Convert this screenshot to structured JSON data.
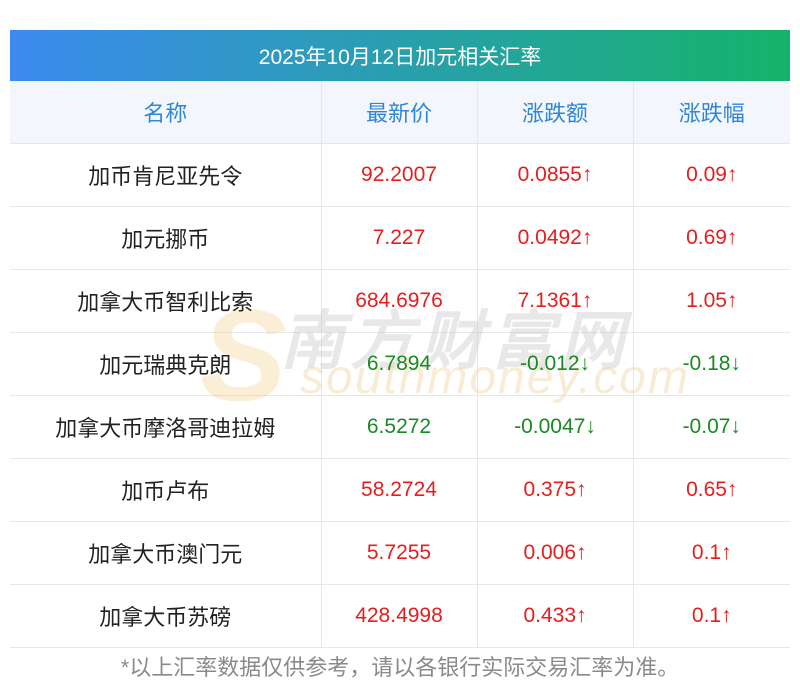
{
  "title": "2025年10月12日加元相关汇率",
  "columns": [
    "名称",
    "最新价",
    "涨跌额",
    "涨跌幅"
  ],
  "rows": [
    {
      "name": "加币肯尼亚先令",
      "price": "92.2007",
      "change": "0.0855↑",
      "pct": "0.09↑",
      "dir": "up"
    },
    {
      "name": "加元挪币",
      "price": "7.227",
      "change": "0.0492↑",
      "pct": "0.69↑",
      "dir": "up"
    },
    {
      "name": "加拿大币智利比索",
      "price": "684.6976",
      "change": "7.1361↑",
      "pct": "1.05↑",
      "dir": "up"
    },
    {
      "name": "加元瑞典克朗",
      "price": "6.7894",
      "change": "-0.012↓",
      "pct": "-0.18↓",
      "dir": "down"
    },
    {
      "name": "加拿大币摩洛哥迪拉姆",
      "price": "6.5272",
      "change": "-0.0047↓",
      "pct": "-0.07↓",
      "dir": "down"
    },
    {
      "name": "加币卢布",
      "price": "58.2724",
      "change": "0.375↑",
      "pct": "0.65↑",
      "dir": "up"
    },
    {
      "name": "加拿大币澳门元",
      "price": "5.7255",
      "change": "0.006↑",
      "pct": "0.1↑",
      "dir": "up"
    },
    {
      "name": "加拿大币苏磅",
      "price": "428.4998",
      "change": "0.433↑",
      "pct": "0.1↑",
      "dir": "up"
    }
  ],
  "watermark": {
    "cn": "南方财富网",
    "en": "southmoney.com",
    "s": "S"
  },
  "footnote": "*以上汇率数据仅供参考，请以各银行实际交易汇率为准。",
  "colors": {
    "up": "#e41e1e",
    "down": "#1a8a24",
    "header_text": "#2f86d6",
    "title_grad_start": "#3d8bf0",
    "title_grad_end": "#15b36a"
  }
}
